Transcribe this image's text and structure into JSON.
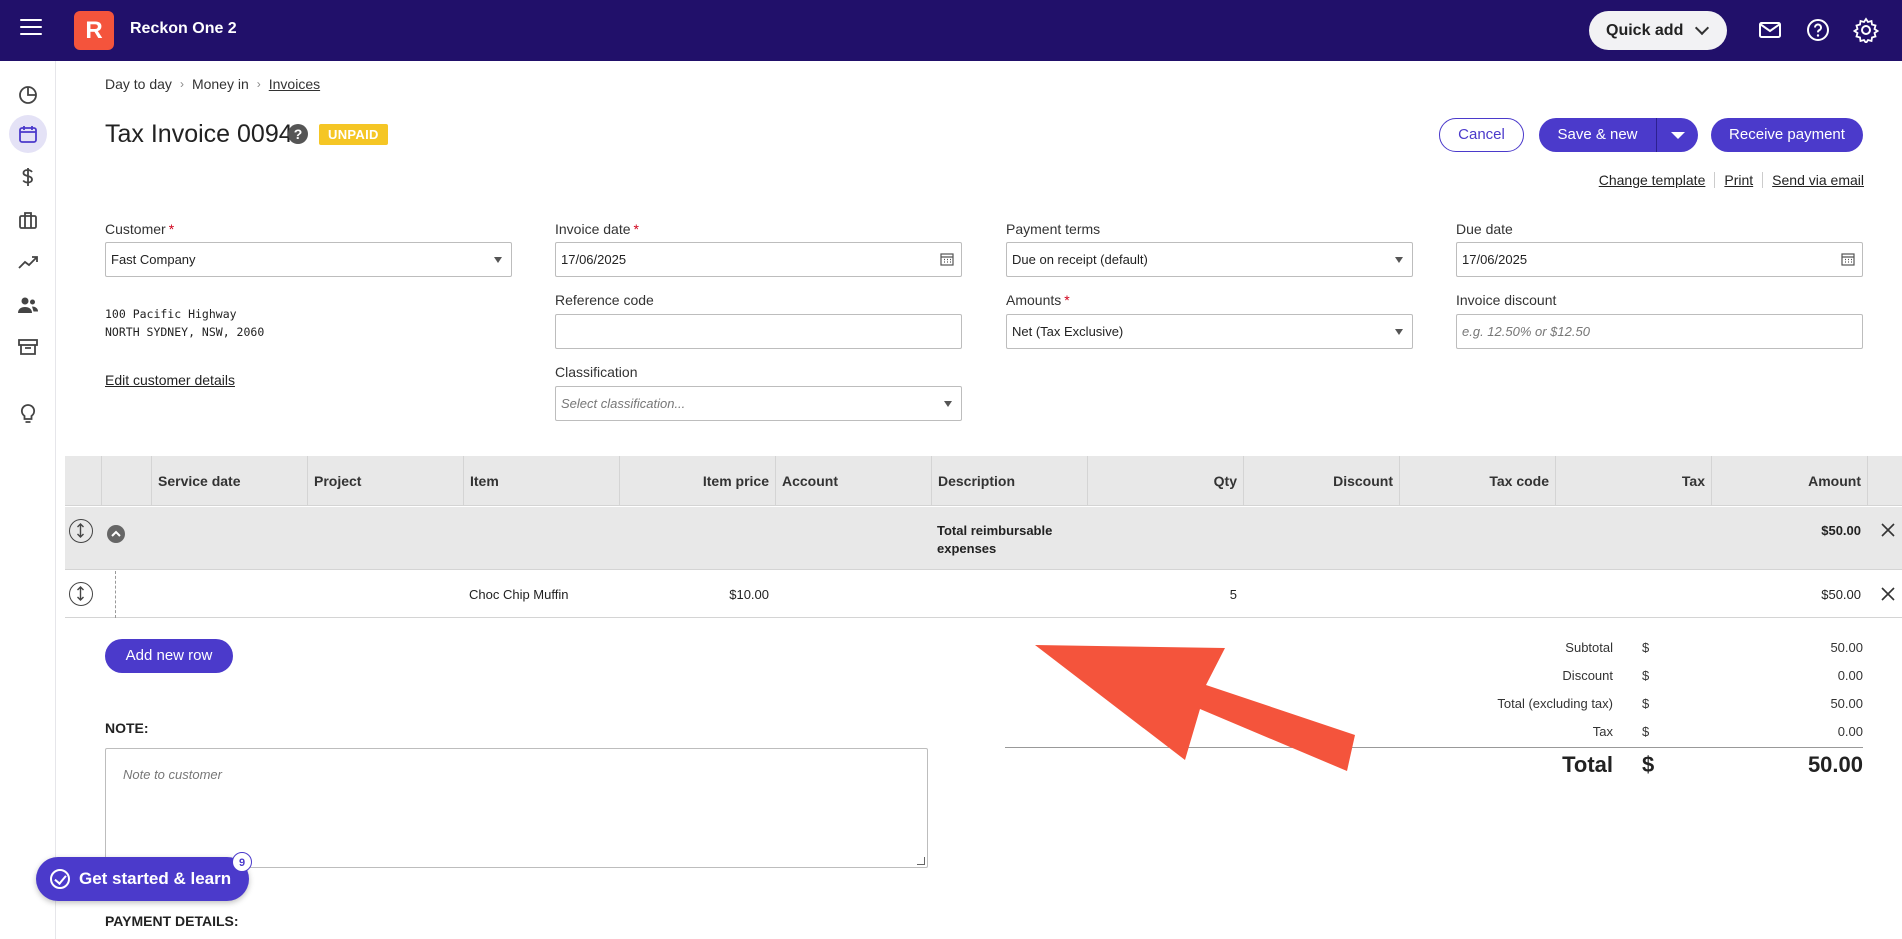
{
  "app": {
    "logo_letter": "R",
    "title": "Reckon One 2"
  },
  "topbar": {
    "quick_add_label": "Quick add"
  },
  "breadcrumb": {
    "items": [
      "Day to day",
      "Money in",
      "Invoices"
    ]
  },
  "header": {
    "title": "Tax Invoice 0094",
    "status_badge": "UNPAID",
    "cancel_label": "Cancel",
    "save_new_label": "Save & new",
    "receive_payment_label": "Receive payment",
    "links": [
      "Change template",
      "Print",
      "Send via email"
    ]
  },
  "form": {
    "customer": {
      "label": "Customer",
      "value": "Fast Company"
    },
    "address_lines": [
      "100 Pacific Highway",
      "NORTH SYDNEY, NSW, 2060"
    ],
    "edit_customer_label": "Edit customer details",
    "invoice_date": {
      "label": "Invoice date",
      "value": "17/06/2025"
    },
    "reference_code": {
      "label": "Reference code",
      "value": ""
    },
    "classification": {
      "label": "Classification",
      "placeholder": "Select classification..."
    },
    "payment_terms": {
      "label": "Payment terms",
      "value": "Due on receipt (default)"
    },
    "amounts": {
      "label": "Amounts",
      "value": "Net (Tax Exclusive)"
    },
    "due_date": {
      "label": "Due date",
      "value": "17/06/2025"
    },
    "invoice_discount": {
      "label": "Invoice discount",
      "placeholder": "e.g. 12.50% or $12.50"
    }
  },
  "table": {
    "columns": [
      "Service date",
      "Project",
      "Item",
      "Item price",
      "Account",
      "Description",
      "Qty",
      "Discount",
      "Tax code",
      "Tax",
      "Amount"
    ],
    "group_row": {
      "description": "Total reimbursable expenses",
      "amount": "$50.00"
    },
    "rows": [
      {
        "service_date": "",
        "project": "",
        "item": "Choc Chip Muffin",
        "item_price": "$10.00",
        "account": "",
        "description": "",
        "qty": "5",
        "discount": "",
        "tax_code": "",
        "tax": "",
        "amount": "$50.00"
      }
    ]
  },
  "add_row_label": "Add new row",
  "totals": {
    "currency": "$",
    "subtotal": {
      "label": "Subtotal",
      "value": "50.00"
    },
    "discount": {
      "label": "Discount",
      "value": "0.00"
    },
    "total_ex_tax": {
      "label": "Total (excluding tax)",
      "value": "50.00"
    },
    "tax": {
      "label": "Tax",
      "value": "0.00"
    },
    "grand_total": {
      "label": "Total",
      "value": "50.00"
    }
  },
  "note": {
    "label": "NOTE:",
    "placeholder": "Note to customer"
  },
  "payment_details_label": "PAYMENT DETAILS:",
  "get_started": {
    "label": "Get started & learn",
    "badge_count": "9"
  },
  "colors": {
    "topbar": "#21106a",
    "primary": "#4b3acb",
    "logo": "#f4543c",
    "badge": "#f5c625",
    "annotation_arrow": "#f4543c"
  }
}
